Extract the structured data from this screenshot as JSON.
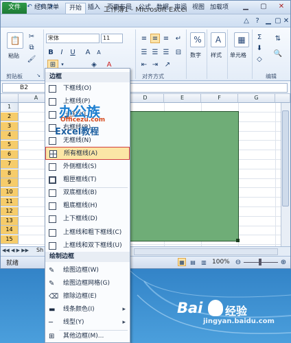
{
  "window": {
    "title": "工作簿1 - Microsoft Excel"
  },
  "tabs": [
    "文件",
    "经典菜单",
    "开始",
    "插入",
    "页面布局",
    "公式",
    "数据",
    "审阅",
    "视图",
    "加载项"
  ],
  "ribbon": {
    "paste_label": "粘贴",
    "font_name": "宋体",
    "font_size": "11",
    "number_label": "数字",
    "styles_label": "样式",
    "cells_label": "单元格",
    "group_clipboard": "剪贴板",
    "group_font": "字",
    "group_alignment": "对齐方式",
    "group_editing": "编辑"
  },
  "formula_bar": {
    "name_box": "B2",
    "fx": "fx"
  },
  "grid": {
    "columns": [
      "A",
      "B",
      "C",
      "D",
      "E",
      "F",
      "G"
    ],
    "rows": [
      "1",
      "2",
      "3",
      "4",
      "5",
      "6",
      "7",
      "8",
      "9",
      "10",
      "11",
      "12",
      "13",
      "14",
      "15"
    ],
    "selected_rows": [
      "2",
      "3",
      "4",
      "5",
      "6",
      "7",
      "8",
      "9",
      "10",
      "11",
      "12",
      "13",
      "14",
      "15"
    ]
  },
  "sheetbar": {
    "tab_partial": "Sh"
  },
  "statusbar": {
    "ready": "就绪",
    "zoom": "100%"
  },
  "menu": {
    "header_borders": "边框",
    "header_draw": "绘制边框",
    "items": [
      {
        "label": "下框线(O)",
        "icon": "border-bottom-icon"
      },
      {
        "label": "上框线(P)",
        "icon": "border-top-icon"
      },
      {
        "label": "左框线(L)",
        "icon": "border-left-icon"
      },
      {
        "label": "右框线(R)",
        "icon": "border-right-icon"
      },
      {
        "label": "无框线(N)",
        "icon": "border-none-icon"
      },
      {
        "label": "所有框线(A)",
        "icon": "border-all-icon"
      },
      {
        "label": "外侧框线(S)",
        "icon": "border-outside-icon"
      },
      {
        "label": "粗匣框线(T)",
        "icon": "border-thick-box-icon"
      },
      {
        "label": "双底框线(B)",
        "icon": "border-double-bottom-icon"
      },
      {
        "label": "粗底框线(H)",
        "icon": "border-thick-bottom-icon"
      },
      {
        "label": "上下框线(D)",
        "icon": "border-top-bottom-icon"
      },
      {
        "label": "上框线和粗下框线(C)",
        "icon": "border-top-thick-bottom-icon"
      },
      {
        "label": "上框线和双下框线(U)",
        "icon": "border-top-double-bottom-icon"
      }
    ],
    "draw_items": [
      {
        "label": "绘图边框(W)",
        "icon": "pencil-icon"
      },
      {
        "label": "绘图边框网格(G)",
        "icon": "grid-pencil-icon"
      },
      {
        "label": "擦除边框(E)",
        "icon": "eraser-icon"
      },
      {
        "label": "线条颜色(I)",
        "icon": "line-color-icon"
      },
      {
        "label": "线型(Y)",
        "icon": "line-style-icon"
      },
      {
        "label": "其他边框(M)...",
        "icon": "more-borders-icon"
      }
    ]
  },
  "watermarks": {
    "officezu_big": "办公族",
    "officezu_url": "Officezu.com",
    "excel_course": "Excel教程",
    "baidu": "Bai",
    "baidu_jingyan": "经验",
    "baidu_url": "jingyan.baidu.com"
  },
  "colors": {
    "accent_green": "#1e7a3c",
    "cell_fill": "#6fad77",
    "highlight": "#fbe6a6"
  }
}
